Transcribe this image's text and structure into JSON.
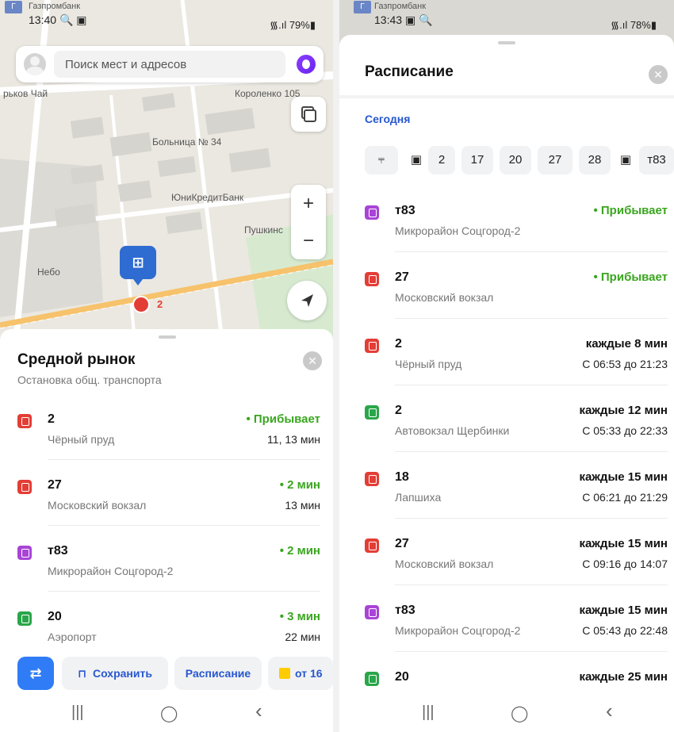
{
  "colors": {
    "red_bus": "#e33e36",
    "green_bus": "#2aa64a",
    "purple_bus": "#a844d6",
    "arrive_green": "#3aa61f",
    "link_blue": "#2757cf",
    "primary_blue": "#2f7cf6"
  },
  "left": {
    "status": {
      "carrier": "Газпромбанк",
      "time": "13:40",
      "time_icons": "🔍 ▣",
      "right": "᯾.ıl 79%▮"
    },
    "search": {
      "placeholder": "Поиск мест и адресов"
    },
    "map_labels": {
      "tea": "рьков Чай",
      "korolenko": "Короленко 105",
      "hospital": "Больница № 34",
      "bank": "ЮниКредитБанк",
      "pushkin": "Пушкинс",
      "nebo": "Небо",
      "bus_count": "2"
    },
    "controls": {
      "zoom_in": "+",
      "zoom_out": "−"
    },
    "sheet": {
      "title": "Средной рынок",
      "subtitle": "Остановка общ. транспорта",
      "rows": [
        {
          "icon": "bus-icon",
          "color": "#e33e36",
          "number": "2",
          "dest": "Чёрный пруд",
          "status": "• Прибывает",
          "times": "11, 13 мин"
        },
        {
          "icon": "bus-icon",
          "color": "#e33e36",
          "number": "27",
          "dest": "Московский вокзал",
          "status": "• 2 мин",
          "times": "13 мин"
        },
        {
          "icon": "minibus-icon",
          "color": "#a844d6",
          "number": "т83",
          "dest": "Микрорайон Соцгород-2",
          "status": "• 2 мин",
          "times": ""
        },
        {
          "icon": "minibus-icon",
          "color": "#2aa64a",
          "number": "20",
          "dest": "Аэропорт",
          "status": "• 3 мин",
          "times": "22 мин"
        }
      ]
    },
    "actions": {
      "route_icon": "route-icon",
      "save": "Сохранить",
      "schedule": "Расписание",
      "taxi": "от 16"
    }
  },
  "right": {
    "status": {
      "carrier": "Газпромбанк",
      "time": "13:43",
      "time_icons": "▣ 🔍",
      "right": "᯾.ıl 78%▮"
    },
    "title": "Расписание",
    "today": "Сегодня",
    "chips": [
      "2",
      "17",
      "20",
      "27",
      "28",
      "т83"
    ],
    "rows": [
      {
        "color": "#a844d6",
        "number": "т83",
        "dest": "Микрорайон Соцгород-2",
        "status": "• Прибывает",
        "times": "",
        "arriving": true
      },
      {
        "color": "#e33e36",
        "number": "27",
        "dest": "Московский вокзал",
        "status": "• Прибывает",
        "times": "",
        "arriving": true
      },
      {
        "color": "#e33e36",
        "number": "2",
        "dest": "Чёрный пруд",
        "status": "каждые 8 мин",
        "times": "С 06:53 до 21:23",
        "arriving": false
      },
      {
        "color": "#2aa64a",
        "number": "2",
        "dest": "Автовокзал Щербинки",
        "status": "каждые 12 мин",
        "times": "С 05:33 до 22:33",
        "arriving": false
      },
      {
        "color": "#e33e36",
        "number": "18",
        "dest": "Лапшиха",
        "status": "каждые 15 мин",
        "times": "С 06:21 до 21:29",
        "arriving": false
      },
      {
        "color": "#e33e36",
        "number": "27",
        "dest": "Московский вокзал",
        "status": "каждые 15 мин",
        "times": "С 09:16 до 14:07",
        "arriving": false
      },
      {
        "color": "#a844d6",
        "number": "т83",
        "dest": "Микрорайон Соцгород-2",
        "status": "каждые 15 мин",
        "times": "С 05:43 до 22:48",
        "arriving": false
      },
      {
        "color": "#2aa64a",
        "number": "20",
        "dest": "",
        "status": "каждые 25 мин",
        "times": "",
        "arriving": false
      }
    ]
  },
  "nav": {
    "recents": "|||",
    "home": "◯",
    "back": "‹"
  }
}
